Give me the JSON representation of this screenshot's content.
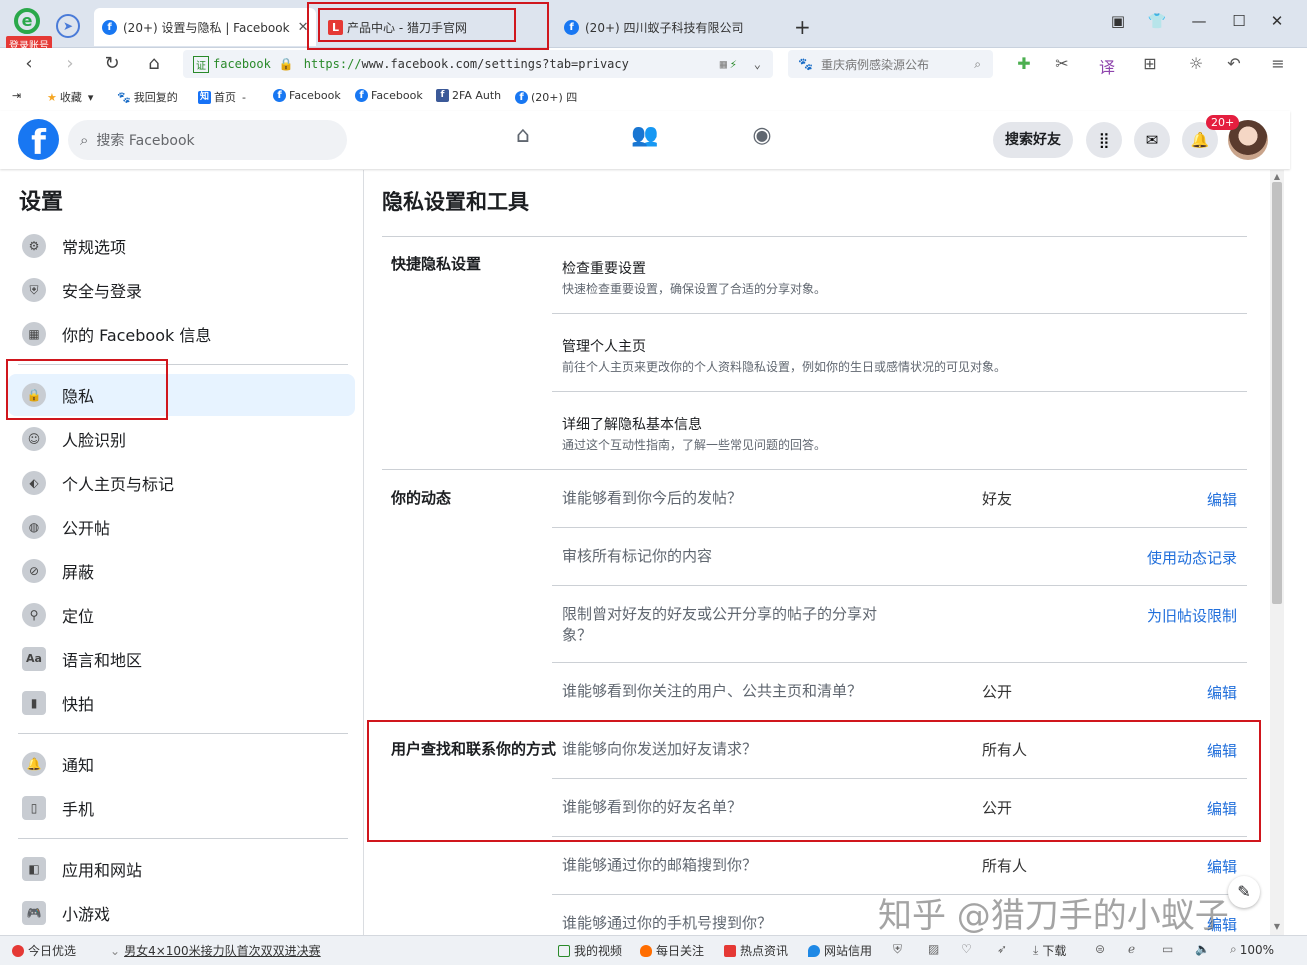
{
  "browser": {
    "login_badge": "登录账号",
    "tabs": [
      {
        "label": "(20+) 设置与隐私 | Facebook"
      },
      {
        "label": "产品中心 - 猎刀手官网"
      },
      {
        "label": "(20+) 四川蚁子科技有限公司"
      }
    ],
    "new_tab": "+",
    "url": {
      "cert": "证",
      "site": "facebook",
      "https": "https://",
      "rest": "www.facebook.com/settings?tab=privacy"
    },
    "search_placeholder": "重庆病例感染源公布",
    "bookmarks": [
      {
        "label": "收藏"
      },
      {
        "label": "我回复的"
      },
      {
        "label": "首页"
      },
      {
        "label": "Facebook"
      },
      {
        "label": "Facebook"
      },
      {
        "label": "2FA Auth"
      },
      {
        "label": "(20+) 四"
      }
    ]
  },
  "fb_header": {
    "search_placeholder": "搜索 Facebook",
    "find_friends": "搜索好友",
    "notif_badge": "20+"
  },
  "sidebar": {
    "title": "设置",
    "group1": [
      {
        "label": "常规选项"
      },
      {
        "label": "安全与登录"
      },
      {
        "label": "你的 Facebook 信息"
      }
    ],
    "group2": [
      {
        "label": "隐私"
      },
      {
        "label": "人脸识别"
      },
      {
        "label": "个人主页与标记"
      },
      {
        "label": "公开帖"
      },
      {
        "label": "屏蔽"
      },
      {
        "label": "定位"
      },
      {
        "label": "语言和地区"
      },
      {
        "label": "快拍"
      }
    ],
    "group3": [
      {
        "label": "通知"
      },
      {
        "label": "手机"
      }
    ],
    "group4": [
      {
        "label": "应用和网站"
      },
      {
        "label": "小游戏"
      }
    ]
  },
  "main": {
    "title": "隐私设置和工具",
    "quick": {
      "label": "快捷隐私设置",
      "items": [
        {
          "title": "检查重要设置",
          "sub": "快速检查重要设置，确保设置了合适的分享对象。"
        },
        {
          "title": "管理个人主页",
          "sub": "前往个人主页来更改你的个人资料隐私设置，例如你的生日或感情状况的可见对象。"
        },
        {
          "title": "详细了解隐私基本信息",
          "sub": "通过这个互动性指南，了解一些常见问题的回答。"
        }
      ]
    },
    "activity": {
      "label": "你的动态",
      "rows": [
        {
          "q": "谁能够看到你今后的发帖？",
          "val": "好友",
          "link": "编辑"
        },
        {
          "q": "审核所有标记你的内容",
          "val": "",
          "link": "使用动态记录"
        },
        {
          "q": "限制曾对好友的好友或公开分享的帖子的分享对象？",
          "val": "",
          "link": "为旧帖设限制"
        },
        {
          "q": "谁能够看到你关注的用户、公共主页和清单？",
          "val": "公开",
          "link": "编辑"
        }
      ]
    },
    "contact": {
      "label": "用户查找和联系你的方式",
      "rows": [
        {
          "q": "谁能够向你发送加好友请求？",
          "val": "所有人",
          "link": "编辑"
        },
        {
          "q": "谁能够看到你的好友名单？",
          "val": "公开",
          "link": "编辑"
        },
        {
          "q": "谁能够通过你的邮箱搜到你？",
          "val": "所有人",
          "link": "编辑"
        },
        {
          "q": "谁能够通过你的手机号搜到你？",
          "val": "",
          "link": "编辑"
        }
      ]
    }
  },
  "watermark": "知乎 @猎刀手的小蚁子",
  "statusbar": {
    "items": [
      {
        "label": "今日优选"
      },
      {
        "label": "男女4×100米接力队首次双双进决赛"
      },
      {
        "label": "我的视频"
      },
      {
        "label": "每日关注"
      },
      {
        "label": "热点资讯"
      },
      {
        "label": "网站信用"
      },
      {
        "label": "下载"
      },
      {
        "label": "100%"
      }
    ]
  }
}
